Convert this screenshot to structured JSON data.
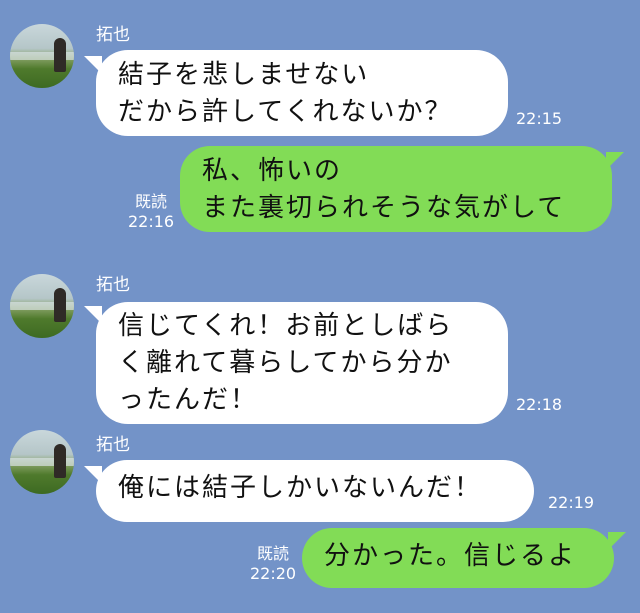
{
  "contact": {
    "name": "拓也"
  },
  "messages": [
    {
      "side": "in",
      "text": "結子を悲しませない\nだから許してくれないか？",
      "time": "22:15"
    },
    {
      "side": "out",
      "text": "私、怖いの\nまた裏切られそうな気がして",
      "read": "既読",
      "time": "22:16"
    },
    {
      "side": "in",
      "text": "信じてくれ！お前としばら\nく離れて暮らしてから分か\nったんだ！",
      "time": "22:18"
    },
    {
      "side": "in",
      "text": "俺には結子しかいないんだ！",
      "time": "22:19"
    },
    {
      "side": "out",
      "text": "分かった。信じるよ",
      "read": "既読",
      "time": "22:20"
    }
  ]
}
